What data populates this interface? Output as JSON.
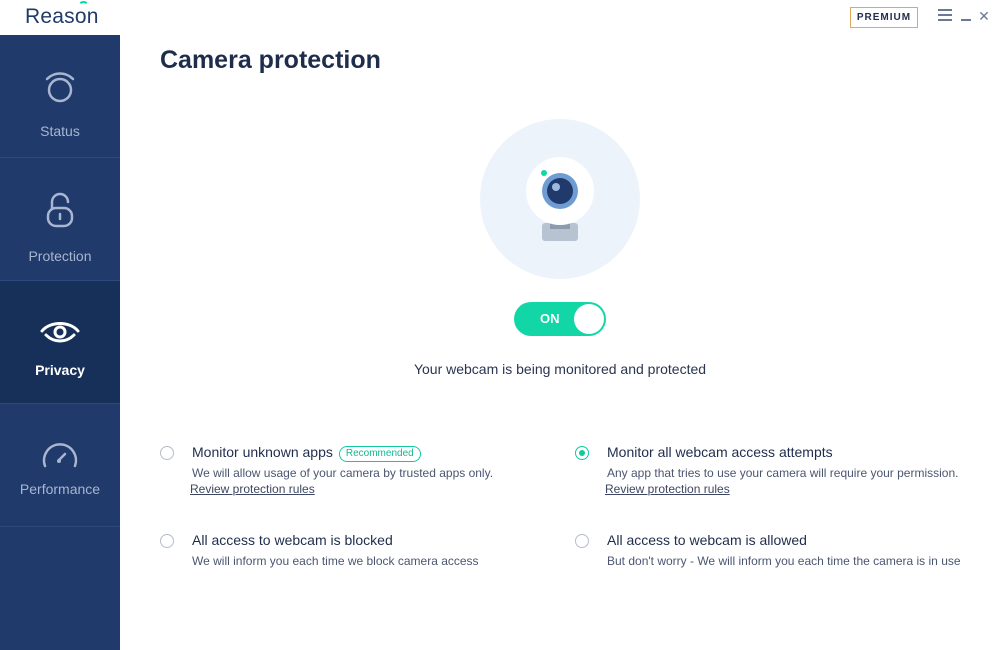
{
  "app": {
    "logo": "Reason",
    "premium": "PREMIUM"
  },
  "window_controls": {
    "menu": "menu-icon",
    "minimize": "minimize-icon",
    "close": "✕"
  },
  "sidebar": {
    "items": [
      {
        "label": "Status",
        "icon": "status-icon",
        "active": false
      },
      {
        "label": "Protection",
        "icon": "lock-icon",
        "active": false
      },
      {
        "label": "Privacy",
        "icon": "eye-icon",
        "active": true
      },
      {
        "label": "Performance",
        "icon": "speedometer-icon",
        "active": false
      }
    ]
  },
  "main": {
    "title": "Camera protection",
    "toggle": {
      "label": "ON",
      "state": true
    },
    "status": "Your webcam is being monitored and protected",
    "options": [
      {
        "title": "Monitor unknown apps",
        "badge": "Recommended",
        "desc": "We will allow usage of your camera by trusted apps only.",
        "link": "Review protection rules",
        "checked": false
      },
      {
        "title": "Monitor all webcam access attempts",
        "desc": "Any app that tries to use your camera will require your permission.",
        "link": "Review protection rules",
        "checked": true
      },
      {
        "title": "All access to webcam is blocked",
        "desc": "We will inform you each time we block camera access",
        "checked": false
      },
      {
        "title": "All access to webcam is allowed",
        "desc": "But don't worry - We will inform you each time the camera is in use",
        "checked": false
      }
    ]
  },
  "colors": {
    "sidebar": "#1f3a6b",
    "accent": "#13d6a6",
    "premium_border": "#e0a95a"
  }
}
